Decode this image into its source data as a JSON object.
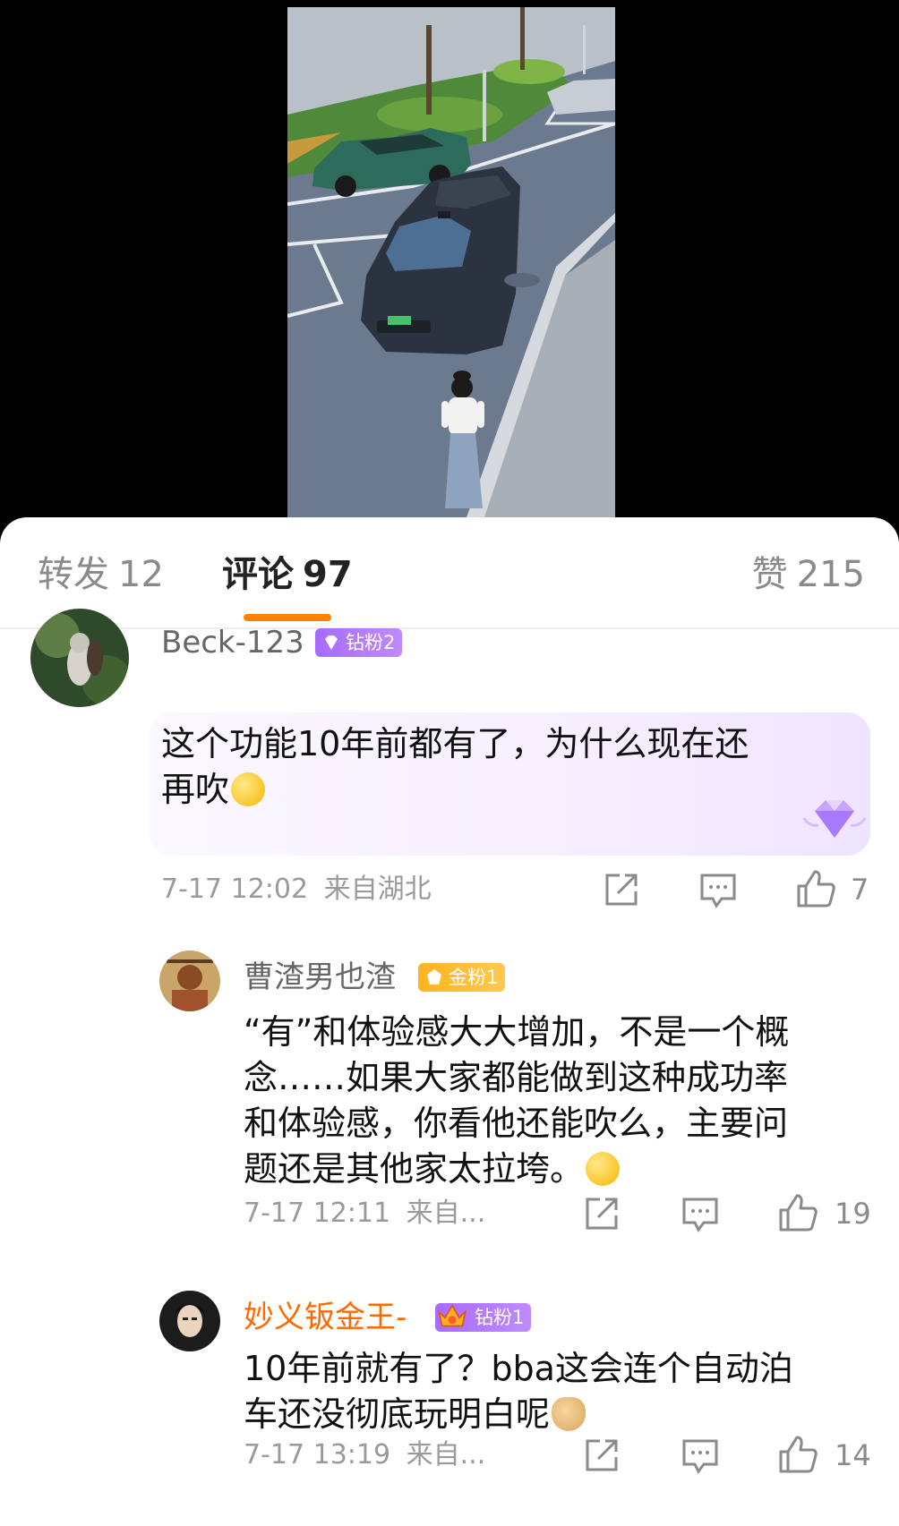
{
  "tabs": {
    "repost": {
      "label": "转发",
      "count": "12"
    },
    "comment": {
      "label": "评论",
      "count": "97"
    },
    "like": {
      "label": "赞",
      "count": "215"
    }
  },
  "comments": [
    {
      "user": "Beck-123",
      "badge": "钻粉2",
      "badge_icon": "diamond-icon",
      "text_line1": "这个功能10年前都有了，为什么现在还",
      "text_line2": "再吹",
      "emoji": "wow-emoji",
      "date": "7-17 12:02",
      "location": "来自湖北",
      "likes": "7"
    },
    {
      "user": "曹渣男也渣",
      "badge": "金粉1",
      "badge_icon": "gold-diamond-icon",
      "lines": [
        "“有”和体验感大大增加，不是一个概",
        "念……如果大家都能做到这种成功率",
        "和体验感，你看他还能吹么，主要问",
        "题还是其他家太拉垮。"
      ],
      "emoji": "laugh-cry-emoji",
      "date": "7-17 12:11",
      "location": "来自...",
      "likes": "19"
    },
    {
      "user": "妙义钣金王-",
      "badge": "钻粉1",
      "badge_icon": "crown-icon",
      "lines": [
        "10年前就有了？bba这会连个自动泊",
        "车还没彻底玩明白呢"
      ],
      "emoji": "doge-emoji",
      "date": "7-17 13:19",
      "location": "来自...",
      "likes": "14"
    }
  ],
  "colors": {
    "accent": "#ff8200",
    "username_vip": "#ff6a00",
    "badge_purple": "#a66bff",
    "badge_gold": "#ffb321"
  }
}
